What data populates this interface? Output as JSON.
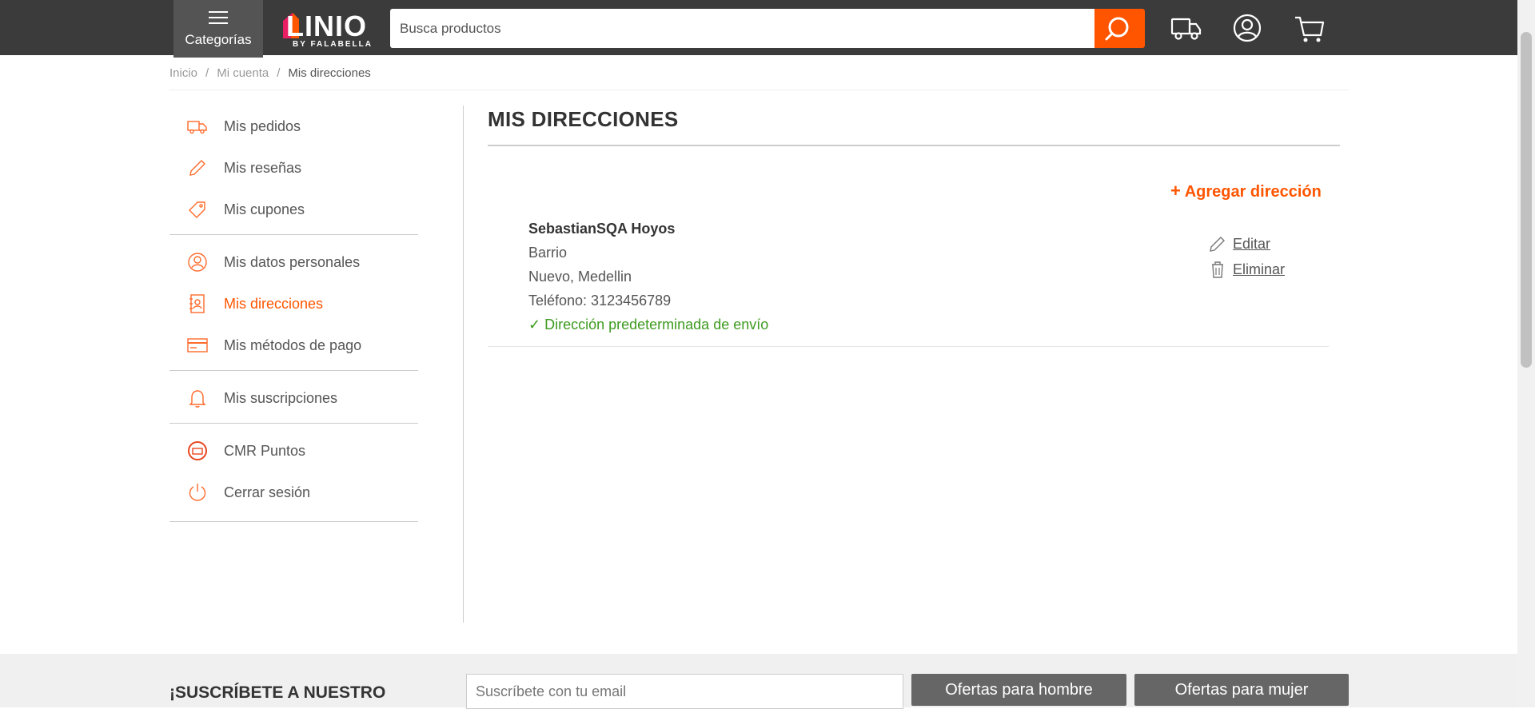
{
  "header": {
    "categories_label": "Categorías",
    "logo_text": "LINIO",
    "logo_sub": "BY FALABELLA",
    "search_placeholder": "Busca productos",
    "accent": "#ff5500"
  },
  "breadcrumb": {
    "items": [
      "Inicio",
      "Mi cuenta",
      "Mis direcciones"
    ],
    "separator": "/"
  },
  "sidebar": {
    "items": [
      {
        "label": "Mis pedidos",
        "icon": "truck-icon"
      },
      {
        "label": "Mis reseñas",
        "icon": "pencil-icon"
      },
      {
        "label": "Mis cupones",
        "icon": "tag-icon"
      },
      {
        "label": "Mis datos personales",
        "icon": "user-icon"
      },
      {
        "label": "Mis direcciones",
        "icon": "address-book-icon",
        "active": true
      },
      {
        "label": "Mis métodos de pago",
        "icon": "credit-card-icon"
      },
      {
        "label": "Mis suscripciones",
        "icon": "bell-icon"
      },
      {
        "label": "CMR Puntos",
        "icon": "cmr-icon"
      },
      {
        "label": "Cerrar sesión",
        "icon": "power-icon"
      }
    ]
  },
  "main": {
    "title": "MIS DIRECCIONES",
    "add_label": "Agregar dirección",
    "address": {
      "name": "SebastianSQA Hoyos",
      "line1": "Barrio",
      "line2": "Nuevo, Medellin",
      "phone": "Teléfono: 3123456789",
      "default_label": "✓ Dirección predeterminada de envío",
      "edit_label": "Editar",
      "delete_label": "Eliminar"
    }
  },
  "newsletter": {
    "title": "¡SUSCRÍBETE A NUESTRO",
    "placeholder": "Suscríbete con tu email",
    "btn_men": "Ofertas para hombre",
    "btn_women": "Ofertas para mujer"
  }
}
